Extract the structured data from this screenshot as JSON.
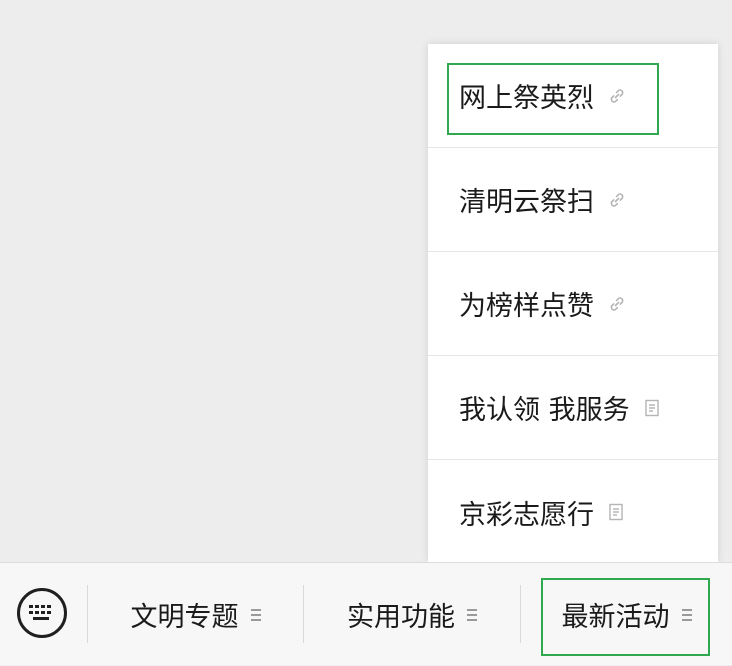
{
  "popup_menu": {
    "items": [
      {
        "label": "网上祭英烈",
        "icon": "link-icon"
      },
      {
        "label": "清明云祭扫",
        "icon": "link-icon"
      },
      {
        "label": "为榜样点赞",
        "icon": "link-icon"
      },
      {
        "label": "我认领 我服务",
        "icon": "document-icon"
      },
      {
        "label": "京彩志愿行",
        "icon": "document-icon"
      }
    ],
    "highlighted_item": "网上祭英烈"
  },
  "bottom_menu": {
    "keyboard_icon": "keyboard-icon",
    "tabs": [
      {
        "label": "文明专题",
        "icon": "menu-lines-icon"
      },
      {
        "label": "实用功能",
        "icon": "menu-lines-icon"
      },
      {
        "label": "最新活动",
        "icon": "menu-lines-icon"
      }
    ],
    "highlighted_tab": "最新活动"
  },
  "colors": {
    "highlight": "#2fa84f",
    "background": "#ededed",
    "popup": "#ffffff",
    "bar": "#f7f7f7"
  }
}
